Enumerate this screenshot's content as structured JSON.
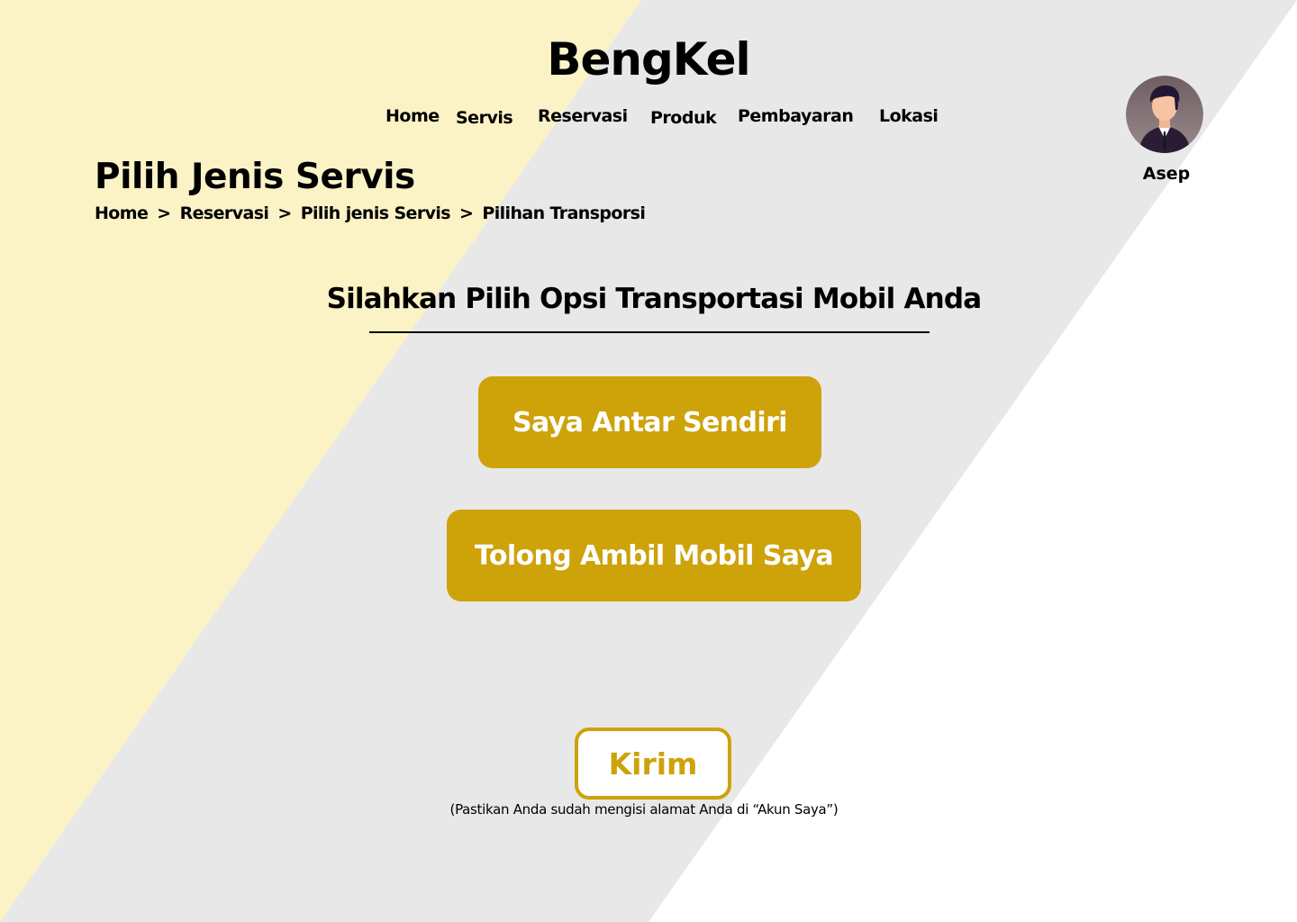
{
  "colors": {
    "background_left": "#fbf2c6",
    "background_middle": "#e8e8e8",
    "background_right": "#ffffff",
    "accent": "#cea209",
    "button_text": "#ffffff",
    "text": "#000000"
  },
  "header": {
    "logo": "BengKel",
    "nav": [
      "Home",
      "Servis",
      "Reservasi",
      "Produk",
      "Pembayaran",
      "Lokasi"
    ],
    "user": {
      "name": "Asep",
      "avatar_icon": "user-avatar-icon"
    }
  },
  "page": {
    "title": "Pilih Jenis Servis",
    "breadcrumb": [
      "Home",
      "Reservasi",
      "Pilih jenis Servis",
      "Pilihan Transporsi"
    ],
    "breadcrumb_separator": ">"
  },
  "main": {
    "heading": "Silahkan Pilih Opsi Transportasi Mobil Anda",
    "options": [
      "Saya Antar Sendiri",
      "Tolong Ambil Mobil Saya"
    ],
    "submit_label": "Kirim",
    "note": "(Pastikan Anda sudah mengisi alamat Anda di “Akun Saya”)"
  }
}
